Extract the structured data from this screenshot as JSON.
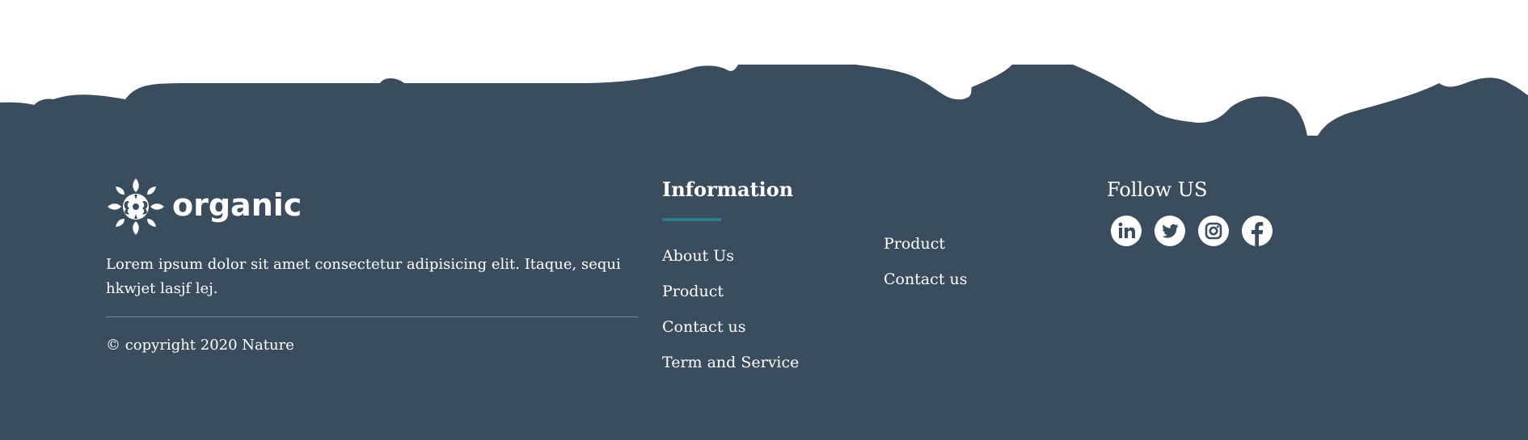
{
  "colors": {
    "footer_bg": "#394d5f",
    "accent": "#2d7c88",
    "text": "#ffffff",
    "divider": "#7b8894"
  },
  "brand": {
    "name": "organic",
    "logo_icon": "mandala-logo-icon",
    "description": "Lorem ipsum dolor sit amet consectetur adipisicing elit. Itaque, sequi hkwjet lasjf lej.",
    "copyright": "© copyright 2020 Nature"
  },
  "information": {
    "heading": "Information",
    "column1": [
      "About Us",
      "Product",
      "Contact us",
      "Term and Service"
    ],
    "column2": [
      "Product",
      "Contact us"
    ]
  },
  "follow": {
    "heading": "Follow US",
    "socials": [
      {
        "name": "linkedin",
        "icon": "linkedin-icon"
      },
      {
        "name": "twitter",
        "icon": "twitter-icon"
      },
      {
        "name": "instagram",
        "icon": "instagram-icon"
      },
      {
        "name": "facebook",
        "icon": "facebook-icon"
      }
    ]
  }
}
